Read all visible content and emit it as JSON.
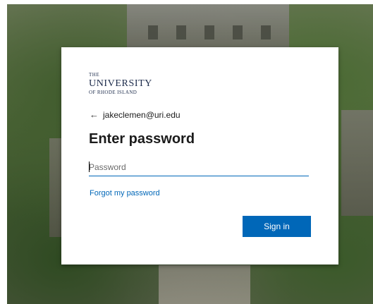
{
  "background": {
    "description_icon": "campus-photo"
  },
  "logo": {
    "line1": "THE",
    "line2": "UNIVERSITY",
    "line3": "OF RHODE ISLAND"
  },
  "account": {
    "back_icon": "back-arrow-icon",
    "back_glyph": "←",
    "email": "jakeclemen@uri.edu"
  },
  "form": {
    "title": "Enter password",
    "password_placeholder": "Password",
    "password_value": "",
    "forgot_label": "Forgot my password",
    "signin_label": "Sign in"
  },
  "colors": {
    "accent": "#0067b8",
    "logo": "#1b2a4a"
  }
}
